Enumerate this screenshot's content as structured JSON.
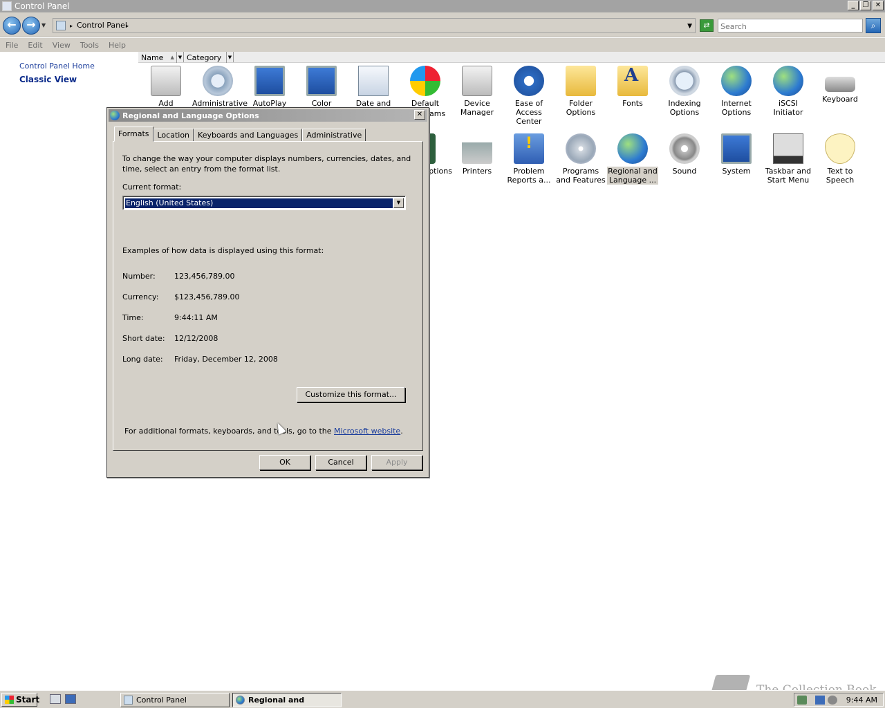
{
  "window": {
    "title": "Control Panel"
  },
  "address": {
    "path_label": "Control Panel",
    "search_placeholder": "Search"
  },
  "menu": [
    "File",
    "Edit",
    "View",
    "Tools",
    "Help"
  ],
  "left_pane": {
    "home_link": "Control Panel Home",
    "classic_view": "Classic View"
  },
  "columns": {
    "name": "Name",
    "category": "Category"
  },
  "icons": {
    "row1": [
      {
        "label": "Add Hardware",
        "icon": "add-hardware-icon"
      },
      {
        "label": "Administrative",
        "icon": "administrative-tools-icon"
      },
      {
        "label": "AutoPlay",
        "icon": "autoplay-icon"
      },
      {
        "label": "Color",
        "icon": "color-icon"
      },
      {
        "label": "Date and Time",
        "icon": "date-time-icon"
      },
      {
        "label": "Default",
        "icon": "default-programs-icon"
      },
      {
        "label": "Device Manager",
        "icon": "device-manager-icon"
      },
      {
        "label": "Ease of Access Center",
        "icon": "ease-of-access-icon"
      },
      {
        "label": "Folder Options",
        "icon": "folder-options-icon"
      },
      {
        "label": "Fonts",
        "icon": "fonts-icon"
      },
      {
        "label": "Indexing Options",
        "icon": "indexing-options-icon"
      },
      {
        "label": "Internet Options",
        "icon": "internet-options-icon"
      },
      {
        "label": "iSCSI Initiator",
        "icon": "iscsi-initiator-icon"
      },
      {
        "label": "Keyboard",
        "icon": "keyboard-icon"
      }
    ],
    "default_programs_tail": "ams",
    "row2": [
      {
        "label": "ptions",
        "icon": "options-icon"
      },
      {
        "label": "Printers",
        "icon": "printers-icon"
      },
      {
        "label": "Problem Reports a...",
        "icon": "problem-reports-icon"
      },
      {
        "label": "Programs and Features",
        "icon": "programs-features-icon"
      },
      {
        "label": "Regional and Language ...",
        "icon": "regional-language-icon"
      },
      {
        "label": "Sound",
        "icon": "sound-icon"
      },
      {
        "label": "System",
        "icon": "system-icon"
      },
      {
        "label": "Taskbar and Start Menu",
        "icon": "taskbar-start-menu-icon"
      },
      {
        "label": "Text to Speech",
        "icon": "text-to-speech-icon"
      }
    ]
  },
  "dialog": {
    "title": "Regional and Language Options",
    "tabs": [
      "Formats",
      "Location",
      "Keyboards and Languages",
      "Administrative"
    ],
    "intro": "To change the way your computer displays numbers, currencies, dates, and time, select an entry from the format list.",
    "current_format_label": "Current format:",
    "current_format_value": "English (United States)",
    "examples_header": "Examples of how data is displayed using this format:",
    "examples": [
      {
        "label": "Number:",
        "value": "123,456,789.00"
      },
      {
        "label": "Currency:",
        "value": "$123,456,789.00"
      },
      {
        "label": "Time:",
        "value": "9:44:11 AM"
      },
      {
        "label": "Short date:",
        "value": "12/12/2008"
      },
      {
        "label": "Long date:",
        "value": "Friday, December 12, 2008"
      }
    ],
    "customize_button": "Customize this format...",
    "additional_text": "For additional formats, keyboards, and tools, go to the",
    "ms_link": "Microsoft website",
    "period": ".",
    "ok": "OK",
    "cancel": "Cancel",
    "apply": "Apply"
  },
  "taskbar": {
    "start": "Start",
    "tasks": [
      "Control Panel",
      "Regional and Langua..."
    ],
    "clock": "9:44 AM"
  },
  "watermark": "The Collection Book"
}
